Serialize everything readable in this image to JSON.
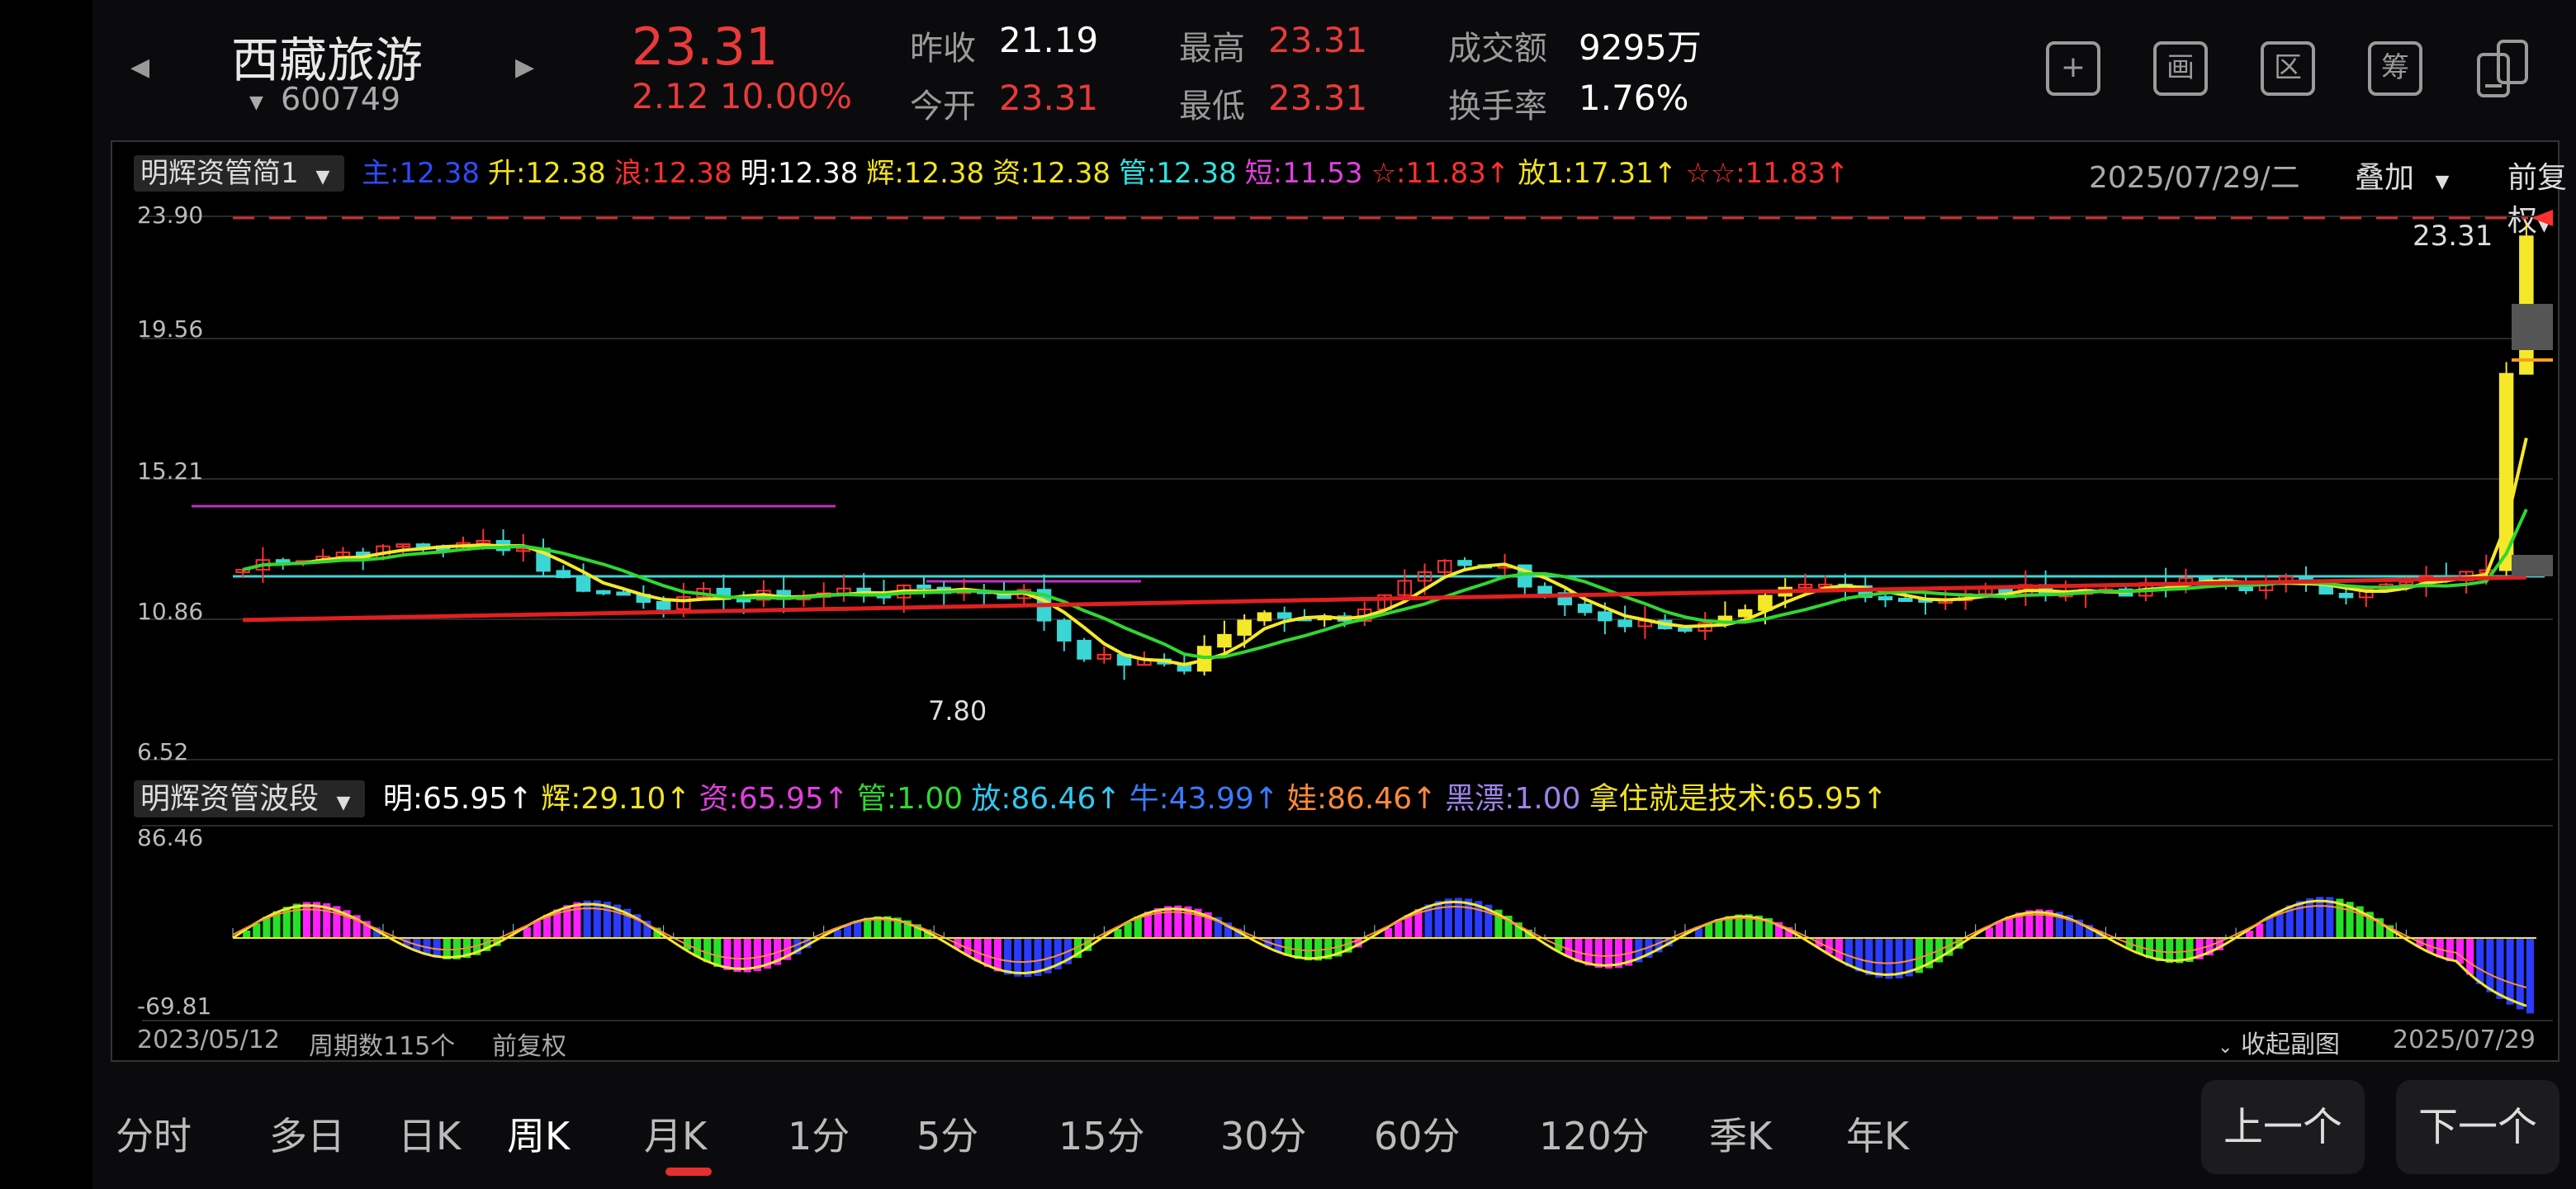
{
  "header": {
    "stock_name": "西藏旅游",
    "stock_code": "600749",
    "price": "23.31",
    "change": "2.12  10.00%",
    "stats": [
      {
        "label": "昨收",
        "value": "21.19",
        "color": "#ffffff"
      },
      {
        "label": "最高",
        "value": "23.31",
        "color": "#e83a3a"
      },
      {
        "label": "成交额",
        "value": "9295万",
        "color": "#ffffff"
      },
      {
        "label": "今开",
        "value": "23.31",
        "color": "#e83a3a"
      },
      {
        "label": "最低",
        "value": "23.31",
        "color": "#e83a3a"
      },
      {
        "label": "换手率",
        "value": "1.76%",
        "color": "#ffffff"
      }
    ],
    "tool_buttons": [
      "+",
      "画",
      "区",
      "筹"
    ]
  },
  "main_indicator": {
    "selector": "明辉资管简1",
    "items": [
      {
        "text": "主:12.38",
        "color": "#2f4bff"
      },
      {
        "text": "升:12.38",
        "color": "#f1e321"
      },
      {
        "text": "浪:12.38",
        "color": "#ff3030"
      },
      {
        "text": "明:12.38",
        "color": "#ffffff"
      },
      {
        "text": "辉:12.38",
        "color": "#f1e321"
      },
      {
        "text": "资:12.38",
        "color": "#f1e321"
      },
      {
        "text": "管:12.38",
        "color": "#31e3e3"
      },
      {
        "text": "短:11.53",
        "color": "#e040e0"
      },
      {
        "text": "☆:11.83↑",
        "color": "#ff3030"
      },
      {
        "text": "放1:17.31↑",
        "color": "#f1e321"
      },
      {
        "text": "☆☆:11.83↑",
        "color": "#ff3030"
      }
    ],
    "date": "2025/07/29/二",
    "overlay_label": "叠加",
    "adjust_label": "前复权"
  },
  "price_axis": {
    "labels": [
      "23.90",
      "19.56",
      "15.21",
      "10.86",
      "6.52"
    ],
    "last_price_label": "23.31",
    "low_label": "7.80"
  },
  "sub_indicator": {
    "selector": "明辉资管波段",
    "items": [
      {
        "text": "明:65.95↑",
        "color": "#ffffff"
      },
      {
        "text": "辉:29.10↑",
        "color": "#f1e321"
      },
      {
        "text": "资:65.95↑",
        "color": "#e040e0"
      },
      {
        "text": "管:1.00",
        "color": "#2fdb2f"
      },
      {
        "text": "放:86.46↑",
        "color": "#31c8f0"
      },
      {
        "text": "牛:43.99↑",
        "color": "#3a7bff"
      },
      {
        "text": "娃:86.46↑",
        "color": "#ff8a3a"
      },
      {
        "text": "黑漂:1.00",
        "color": "#9d84e8"
      },
      {
        "text": "拿住就是技术:65.95↑",
        "color": "#f1e321"
      }
    ],
    "axis_labels": [
      "86.46",
      "-69.81"
    ]
  },
  "footer": {
    "start_date": "2023/05/12",
    "period_count": "周期数115个",
    "adjust": "前复权",
    "collapse": "收起副图",
    "end_date": "2025/07/29"
  },
  "tabs": [
    "分时",
    "多日",
    "日K",
    "周K",
    "月K",
    "1分",
    "5分",
    "15分",
    "30分",
    "60分",
    "120分",
    "季K",
    "年K"
  ],
  "active_tab": "周K",
  "nav": {
    "prev": "上一个",
    "next": "下一个"
  }
}
